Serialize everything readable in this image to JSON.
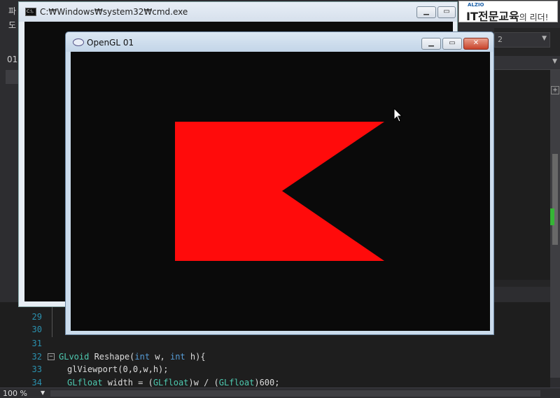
{
  "vs": {
    "menu": [
      "파",
      "도"
    ],
    "left_tab": "01",
    "combo_value": "2",
    "zoom": "100 %"
  },
  "code": {
    "lines": [
      {
        "num": "29",
        "text": ""
      },
      {
        "num": "30",
        "text": ""
      },
      {
        "num": "31",
        "text": ""
      },
      {
        "num": "32",
        "text": ""
      },
      {
        "num": "33",
        "text": ""
      },
      {
        "num": "34",
        "text": ""
      }
    ],
    "line32": {
      "type": "GLvoid",
      "name": " Reshape(",
      "kw1": "int",
      "p1": " w, ",
      "kw2": "int",
      "p2": " h){"
    },
    "line33": {
      "text": "glViewport(0,0,w,h);"
    },
    "line34": {
      "type1": "GLfloat",
      "p1": " width = (",
      "type2": "GLfloat",
      "p2": ")w / (",
      "type3": "GLfloat",
      "p3": ")600;"
    }
  },
  "cmd": {
    "title": "C:₩Windows₩system32₩cmd.exe",
    "icon_text": "C:\\."
  },
  "logo": {
    "small": "ALZIO",
    "main": "IT전문교육",
    "tail": "의 리더!"
  },
  "gl": {
    "title": "OpenGL 01",
    "shape_color": "#ff0b0b",
    "background": "#0a0a0a"
  },
  "icons": {
    "cmd": "console-icon",
    "gl": "opengl-app-icon",
    "minimize": "minimize-icon",
    "maximize": "maximize-icon",
    "close": "close-icon",
    "cursor": "mouse-pointer-icon"
  }
}
